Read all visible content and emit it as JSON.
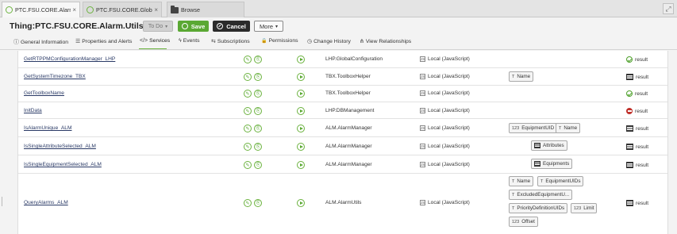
{
  "tabs": [
    {
      "label": "PTC.FSU.CORE.Alarm.U...",
      "icon": "thing-icon",
      "closable": true
    },
    {
      "label": "PTC.FSU.CORE.GlobalC...",
      "icon": "thing-icon",
      "closable": true
    },
    {
      "label": "Browse",
      "icon": "folder-icon",
      "closable": false
    }
  ],
  "tab_close_glyph": "×",
  "header": {
    "title": "Thing:PTC.FSU.CORE.Alarm.Utils_TG",
    "help_glyph": "?",
    "todo_label": "To Do",
    "save_label": "Save",
    "cancel_label": "Cancel",
    "more_label": "More"
  },
  "subnav": [
    {
      "label": "General Information",
      "icon": "info-icon",
      "glyph": "ⓘ"
    },
    {
      "label": "Properties and Alerts",
      "icon": "list-icon",
      "glyph": "☰"
    },
    {
      "label": "Services",
      "icon": "code-icon",
      "glyph": "</>",
      "active": true
    },
    {
      "label": "Events",
      "icon": "lightning-icon",
      "glyph": "ϟ"
    },
    {
      "label": "Subscriptions",
      "icon": "subscription-icon",
      "glyph": "⇆"
    },
    {
      "label": "Permissions",
      "icon": "lock-icon",
      "glyph": "🔒"
    },
    {
      "label": "Change History",
      "icon": "history-icon",
      "glyph": "◷"
    },
    {
      "label": "View Relationships",
      "icon": "relationships-icon",
      "glyph": "⋔"
    }
  ],
  "services": [
    {
      "name": "GetRTPPMConfigurationManager_LHP",
      "thing": "LHP.GlobalConfiguration",
      "handler": "Local (JavaScript)",
      "inputs": [],
      "result": "result",
      "result_type": "json"
    },
    {
      "name": "GetSystemTimezone_TBX",
      "thing": "TBX.ToolboxHelper",
      "handler": "Local (JavaScript)",
      "inputs": [
        {
          "type": "T",
          "label": "Name"
        }
      ],
      "result": "result",
      "result_type": "infotable"
    },
    {
      "name": "GetToolboxName",
      "thing": "TBX.ToolboxHelper",
      "handler": "Local (JavaScript)",
      "inputs": [],
      "result": "result",
      "result_type": "json"
    },
    {
      "name": "InitData",
      "thing": "LHP.DBManagement",
      "handler": "Local (JavaScript)",
      "inputs": [],
      "result": "result",
      "result_type": "nothing"
    },
    {
      "name": "IsAlarmUnique_ALM",
      "thing": "ALM.AlarmManager",
      "handler": "Local (JavaScript)",
      "inputs": [
        {
          "type": "123",
          "label": "EquipmentUID"
        },
        {
          "type": "T",
          "label": "Name"
        }
      ],
      "result": "result",
      "result_type": "infotable"
    },
    {
      "name": "IsSingleAttributeSelected_ALM",
      "thing": "ALM.AlarmManager",
      "handler": "Local (JavaScript)",
      "inputs": [
        {
          "type": "table",
          "label": "Attributes"
        }
      ],
      "result": "result",
      "result_type": "infotable"
    },
    {
      "name": "IsSingleEquipmentSelected_ALM",
      "thing": "ALM.AlarmManager",
      "handler": "Local (JavaScript)",
      "inputs": [
        {
          "type": "table",
          "label": "Equipments"
        }
      ],
      "result": "result",
      "result_type": "infotable"
    },
    {
      "name": "QueryAlarms_ALM",
      "thing": "ALM.AlarmUtils",
      "handler": "Local (JavaScript)",
      "inputs": [
        {
          "type": "T",
          "label": "Name"
        },
        {
          "type": "T",
          "label": "EquipmentUIDs"
        },
        {
          "type": "T",
          "label": "ExcludedEquipmentU..."
        },
        {
          "type": "T",
          "label": "PriorityDefinitionUIDs"
        },
        {
          "type": "123",
          "label": "Limit"
        },
        {
          "type": "123",
          "label": "Offset"
        }
      ],
      "result": "result",
      "result_type": "infotable"
    }
  ],
  "glyphs": {
    "js": "JS",
    "edit": "✎",
    "copy": "⎘",
    "caret": "▾",
    "expand": "⤢"
  },
  "colors": {
    "accent_green": "#6cb33f",
    "save_green": "#5aa833",
    "cancel_dark": "#2b2b2b",
    "nothing_red": "#c0302a"
  }
}
